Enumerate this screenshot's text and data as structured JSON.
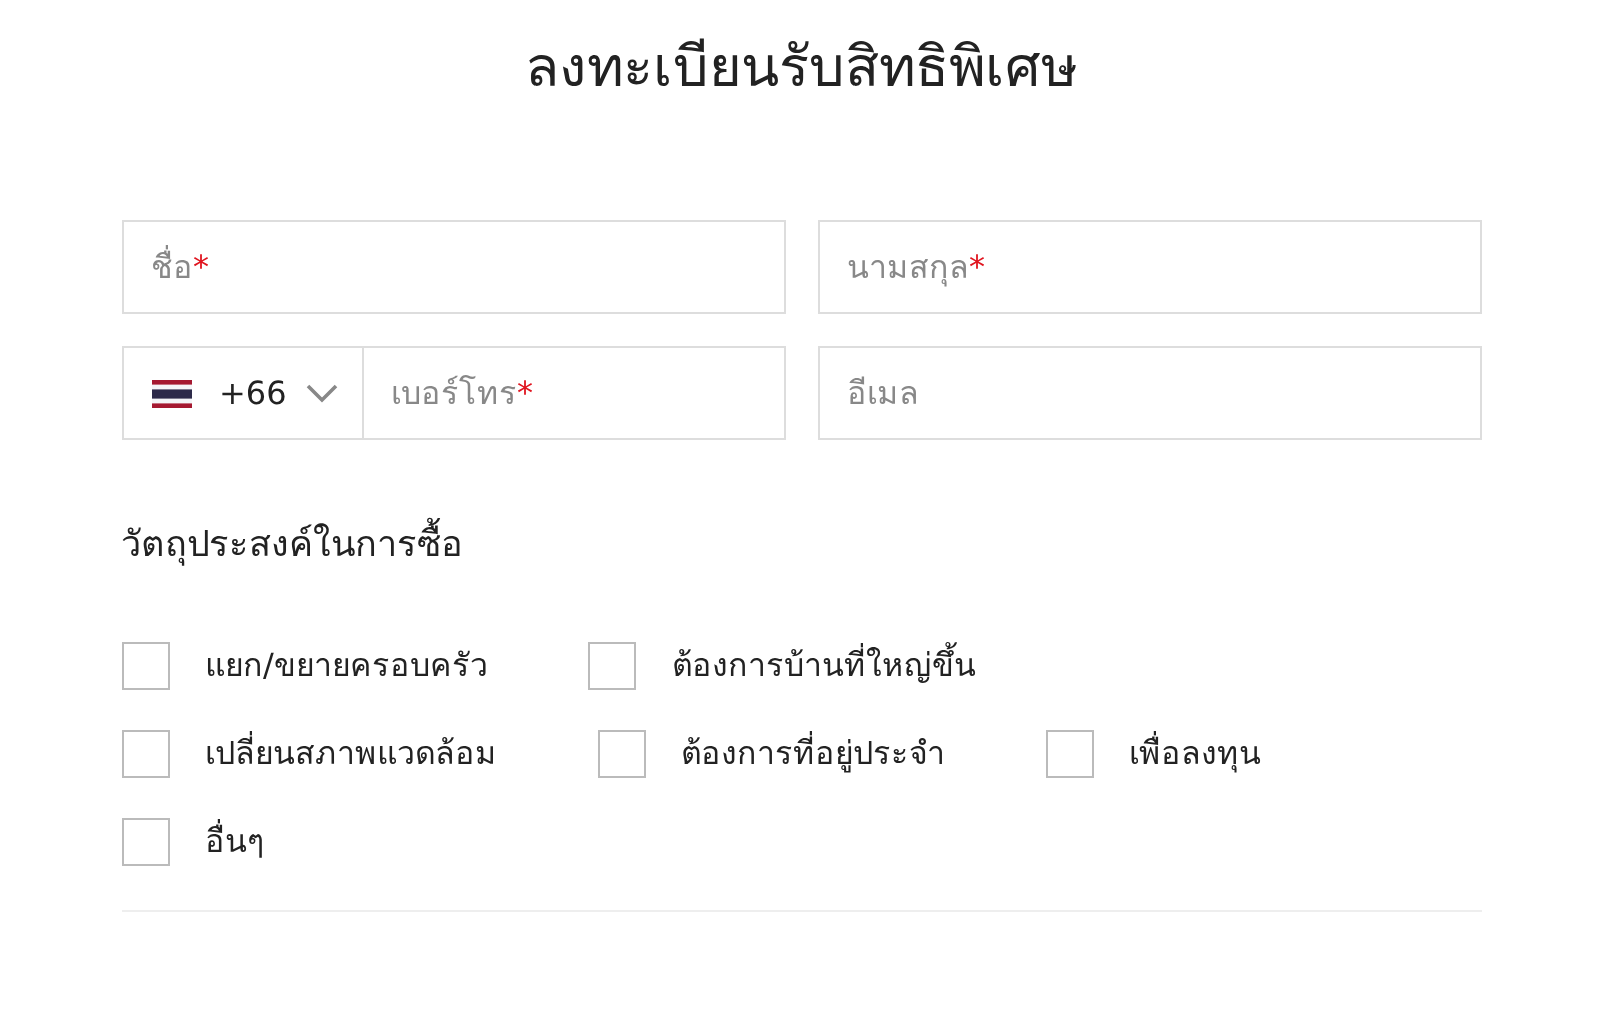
{
  "title": "ลงทะเบียนรับสิทธิพิเศษ",
  "name_fields": [
    {
      "placeholder": "ชื่อ",
      "required_mark": "*"
    },
    {
      "placeholder": "นามสกุล",
      "required_mark": "*"
    }
  ],
  "phone": {
    "country_code": "+66",
    "placeholder": "เบอร์โทร",
    "required_mark": "*"
  },
  "email": {
    "placeholder": "อีเมล"
  },
  "purpose": {
    "heading": "วัตถุประสงค์ในการซื้อ",
    "option_rows": [
      [
        {
          "label": "แยก/ขยายครอบครัว",
          "checked": false
        },
        {
          "label": "ต้องการบ้านที่ใหญ่ขึ้น",
          "checked": false
        }
      ],
      [
        {
          "label": "เปลี่ยนสภาพแวดล้อม",
          "checked": false
        },
        {
          "label": "ต้องการที่อยู่ประจำ",
          "checked": false
        },
        {
          "label": "เพื่อลงทุน",
          "checked": false
        }
      ],
      [
        {
          "label": "อื่นๆ",
          "checked": false
        }
      ]
    ]
  }
}
